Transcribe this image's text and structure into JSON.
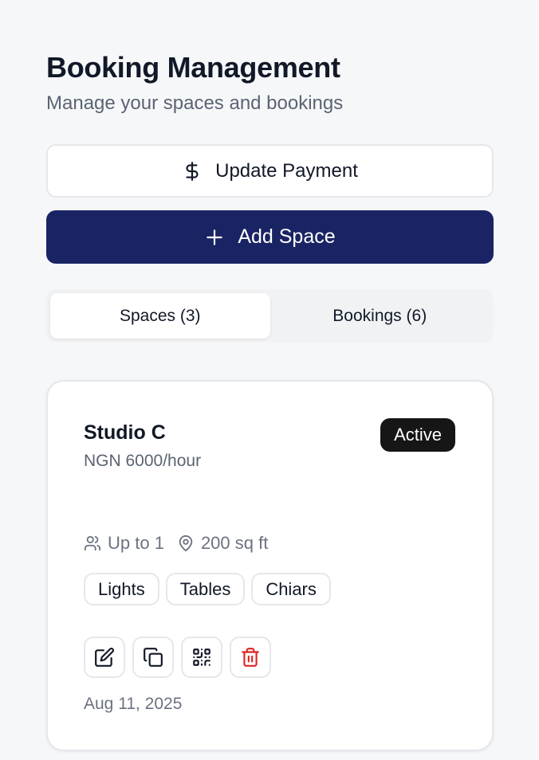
{
  "header": {
    "title": "Booking Management",
    "subtitle": "Manage your spaces and bookings"
  },
  "buttons": {
    "update_payment": {
      "label": "Update Payment",
      "icon": "dollar-icon"
    },
    "add_space": {
      "label": "Add Space",
      "icon": "plus-icon"
    }
  },
  "tabs": [
    {
      "label": "Spaces (3)",
      "active": true
    },
    {
      "label": "Bookings (6)",
      "active": false
    }
  ],
  "space_card": {
    "name": "Studio C",
    "price": "NGN 6000/hour",
    "status": "Active",
    "capacity": "Up to 1",
    "size": "200 sq ft",
    "amenities": [
      "Lights",
      "Tables",
      "Chiars"
    ],
    "actions": [
      {
        "icon": "edit-icon"
      },
      {
        "icon": "copy-icon"
      },
      {
        "icon": "qr-code-icon"
      },
      {
        "icon": "trash-icon"
      }
    ],
    "date": "Aug 11, 2025"
  },
  "colors": {
    "primary": "#1a2464",
    "badge_bg": "#161616",
    "danger": "#dc2626",
    "background": "#f6f7f9"
  }
}
